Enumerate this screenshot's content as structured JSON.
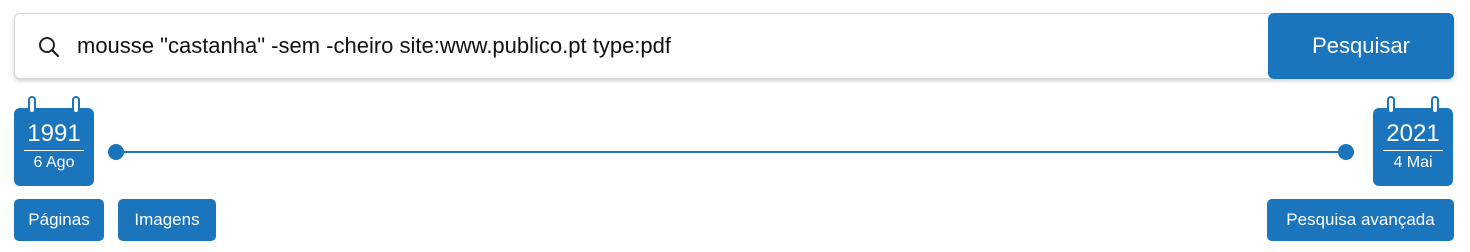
{
  "search": {
    "query": "mousse \"castanha\" -sem -cheiro site:www.publico.pt type:pdf",
    "button_label": "Pesquisar",
    "icon": "search-icon"
  },
  "date_range": {
    "start": {
      "year": "1991",
      "day_month": "6 Ago"
    },
    "end": {
      "year": "2021",
      "day_month": "4 Mai"
    }
  },
  "buttons": {
    "paginas": "Páginas",
    "imagens": "Imagens",
    "advanced": "Pesquisa avançada"
  },
  "colors": {
    "accent": "#1b75bc",
    "border": "#d9d9d9"
  }
}
